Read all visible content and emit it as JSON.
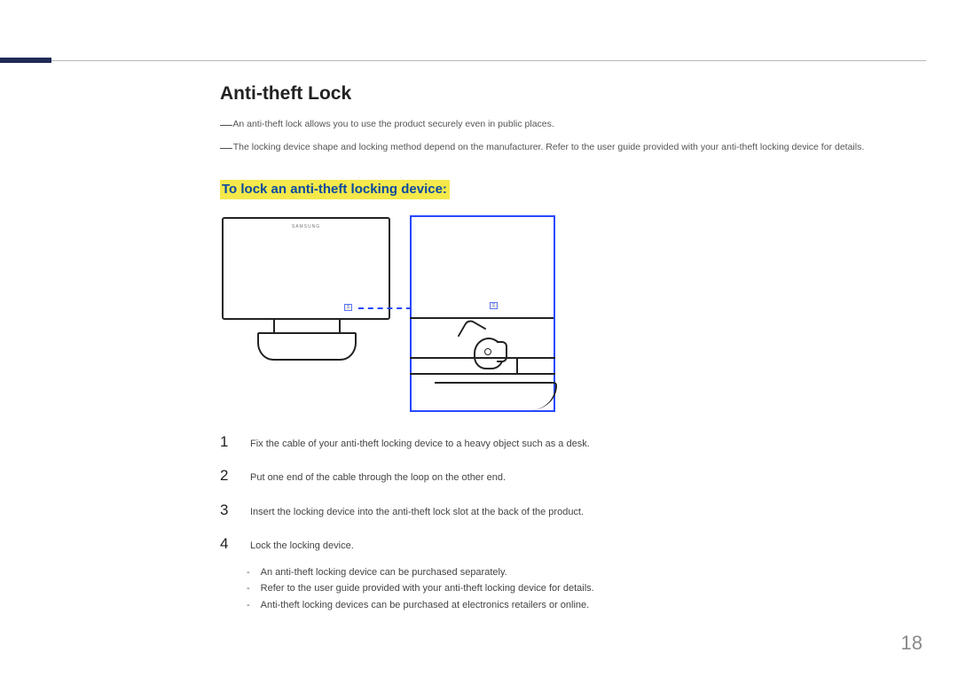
{
  "section_title": "Anti-theft Lock",
  "notes": [
    "An anti-theft lock allows you to use the product securely even in public places.",
    "The locking device shape and locking method depend on the manufacturer. Refer to the user guide provided with your anti-theft locking device for details."
  ],
  "subheading": "To lock an anti-theft locking device:",
  "figure": {
    "tv_brand": "SAMSUNG",
    "slot_label": "⍂"
  },
  "steps": [
    "Fix the cable of your anti-theft locking device to a heavy object such as a desk.",
    "Put one end of the cable through the loop on the other end.",
    "Insert the locking device into the anti-theft lock slot at the back of the product.",
    "Lock the locking device."
  ],
  "sub_items": [
    "An anti-theft locking device can be purchased separately.",
    "Refer to the user guide provided with your anti-theft locking device for details.",
    "Anti-theft locking devices can be purchased at electronics retailers or online."
  ],
  "page_number": "18"
}
